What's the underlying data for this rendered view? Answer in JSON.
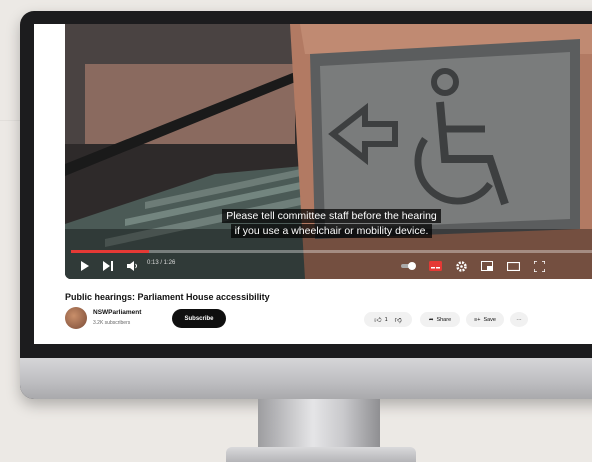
{
  "video": {
    "caption_line1": "Please tell committee staff before the hearing",
    "caption_line2": "if you use a wheelchair or mobility device.",
    "time": "0:13 / 1:26",
    "progress": 0.15
  },
  "title": "Public hearings: Parliament House accessibility",
  "channel": {
    "name": "NSWParliament",
    "subscribers": "3.2K subscribers",
    "subscribe_label": "Subscribe"
  },
  "actions": {
    "like_count": "1",
    "share_label": "Share",
    "save_label": "Save",
    "more_label": "···"
  },
  "colors": {
    "progress": "#e53935",
    "subscribe_bg": "#0f0f0f"
  }
}
